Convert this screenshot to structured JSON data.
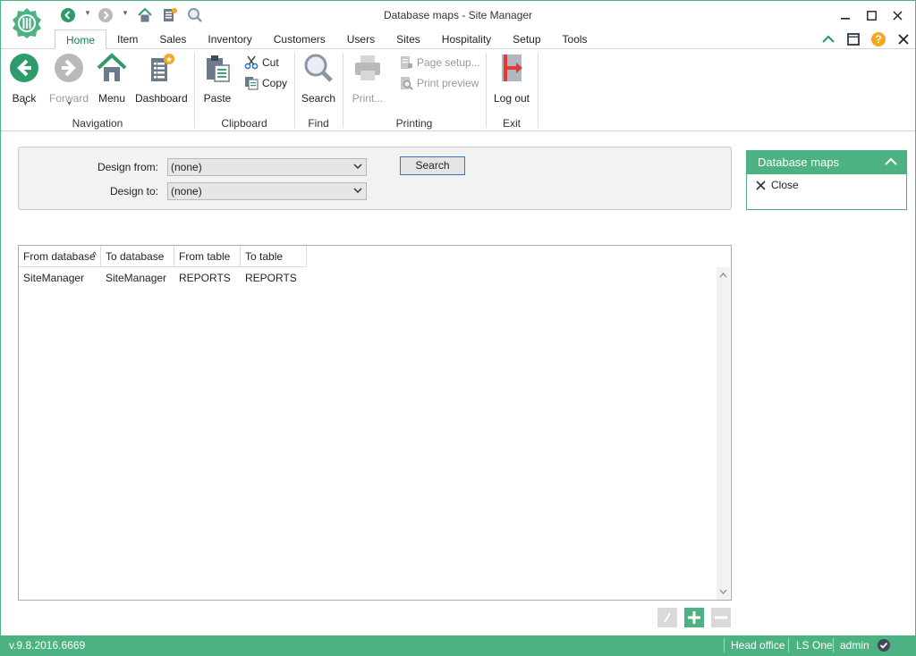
{
  "window": {
    "title": "Database maps - Site Manager"
  },
  "colors": {
    "accent": "#4db281",
    "accent_dark": "#1a7a4c",
    "logout_red": "#e53935",
    "dashboard_orange": "#f5a623"
  },
  "tabs": [
    "Home",
    "Item",
    "Sales",
    "Inventory",
    "Customers",
    "Users",
    "Sites",
    "Hospitality",
    "Setup",
    "Tools"
  ],
  "ribbon": {
    "navigation": {
      "group": "Navigation",
      "back": "Back",
      "forward": "Forward",
      "menu": "Menu",
      "dashboard": "Dashboard"
    },
    "clipboard": {
      "group": "Clipboard",
      "paste": "Paste",
      "cut": "Cut",
      "copy": "Copy"
    },
    "find": {
      "group": "Find",
      "search": "Search"
    },
    "printing": {
      "group": "Printing",
      "print": "Print...",
      "page_setup": "Page setup...",
      "print_preview": "Print preview"
    },
    "exit": {
      "group": "Exit",
      "logout": "Log out"
    }
  },
  "search_panel": {
    "design_from_label": "Design from:",
    "design_from_value": "(none)",
    "design_to_label": "Design to:",
    "design_to_value": "(none)",
    "search_button": "Search"
  },
  "side_panel": {
    "title": "Database maps",
    "close": "Close"
  },
  "grid": {
    "columns": [
      "From database",
      "To database",
      "From table",
      "To table"
    ],
    "rows": [
      [
        "SiteManager",
        "SiteManager",
        "REPORTS",
        "REPORTS"
      ]
    ]
  },
  "statusbar": {
    "version": "v.9.8.2016.6669",
    "store": "Head office",
    "product": "LS One",
    "user": "admin"
  }
}
